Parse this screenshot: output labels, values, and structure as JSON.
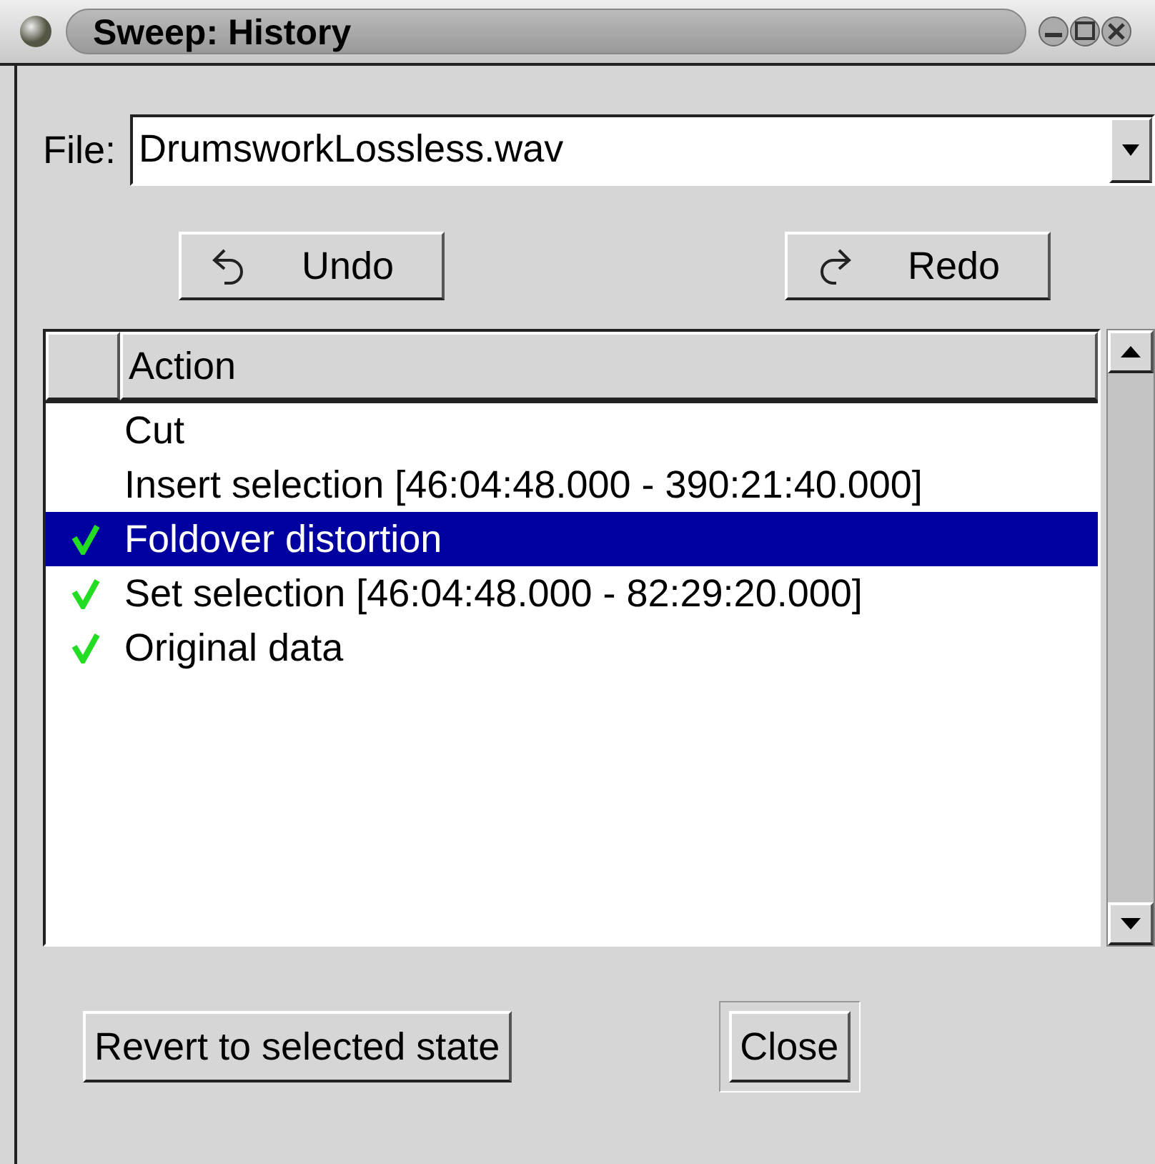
{
  "window": {
    "title": "Sweep: History"
  },
  "file": {
    "label": "File:",
    "value": "DrumsworkLossless.wav"
  },
  "undo_button": {
    "label": "Undo"
  },
  "redo_button": {
    "label": "Redo"
  },
  "table": {
    "columns": [
      "Action"
    ],
    "rows": [
      {
        "action": "Cut",
        "applied": false,
        "selected": false
      },
      {
        "action": "Insert selection [46:04:48.000 - 390:21:40.000]",
        "applied": false,
        "selected": false
      },
      {
        "action": "Foldover distortion",
        "applied": true,
        "selected": true
      },
      {
        "action": "Set selection [46:04:48.000 - 82:29:20.000]",
        "applied": true,
        "selected": false
      },
      {
        "action": "Original data",
        "applied": true,
        "selected": false
      }
    ]
  },
  "revert_button": {
    "label": "Revert to selected state"
  },
  "close_button": {
    "label": "Close",
    "default": true
  }
}
